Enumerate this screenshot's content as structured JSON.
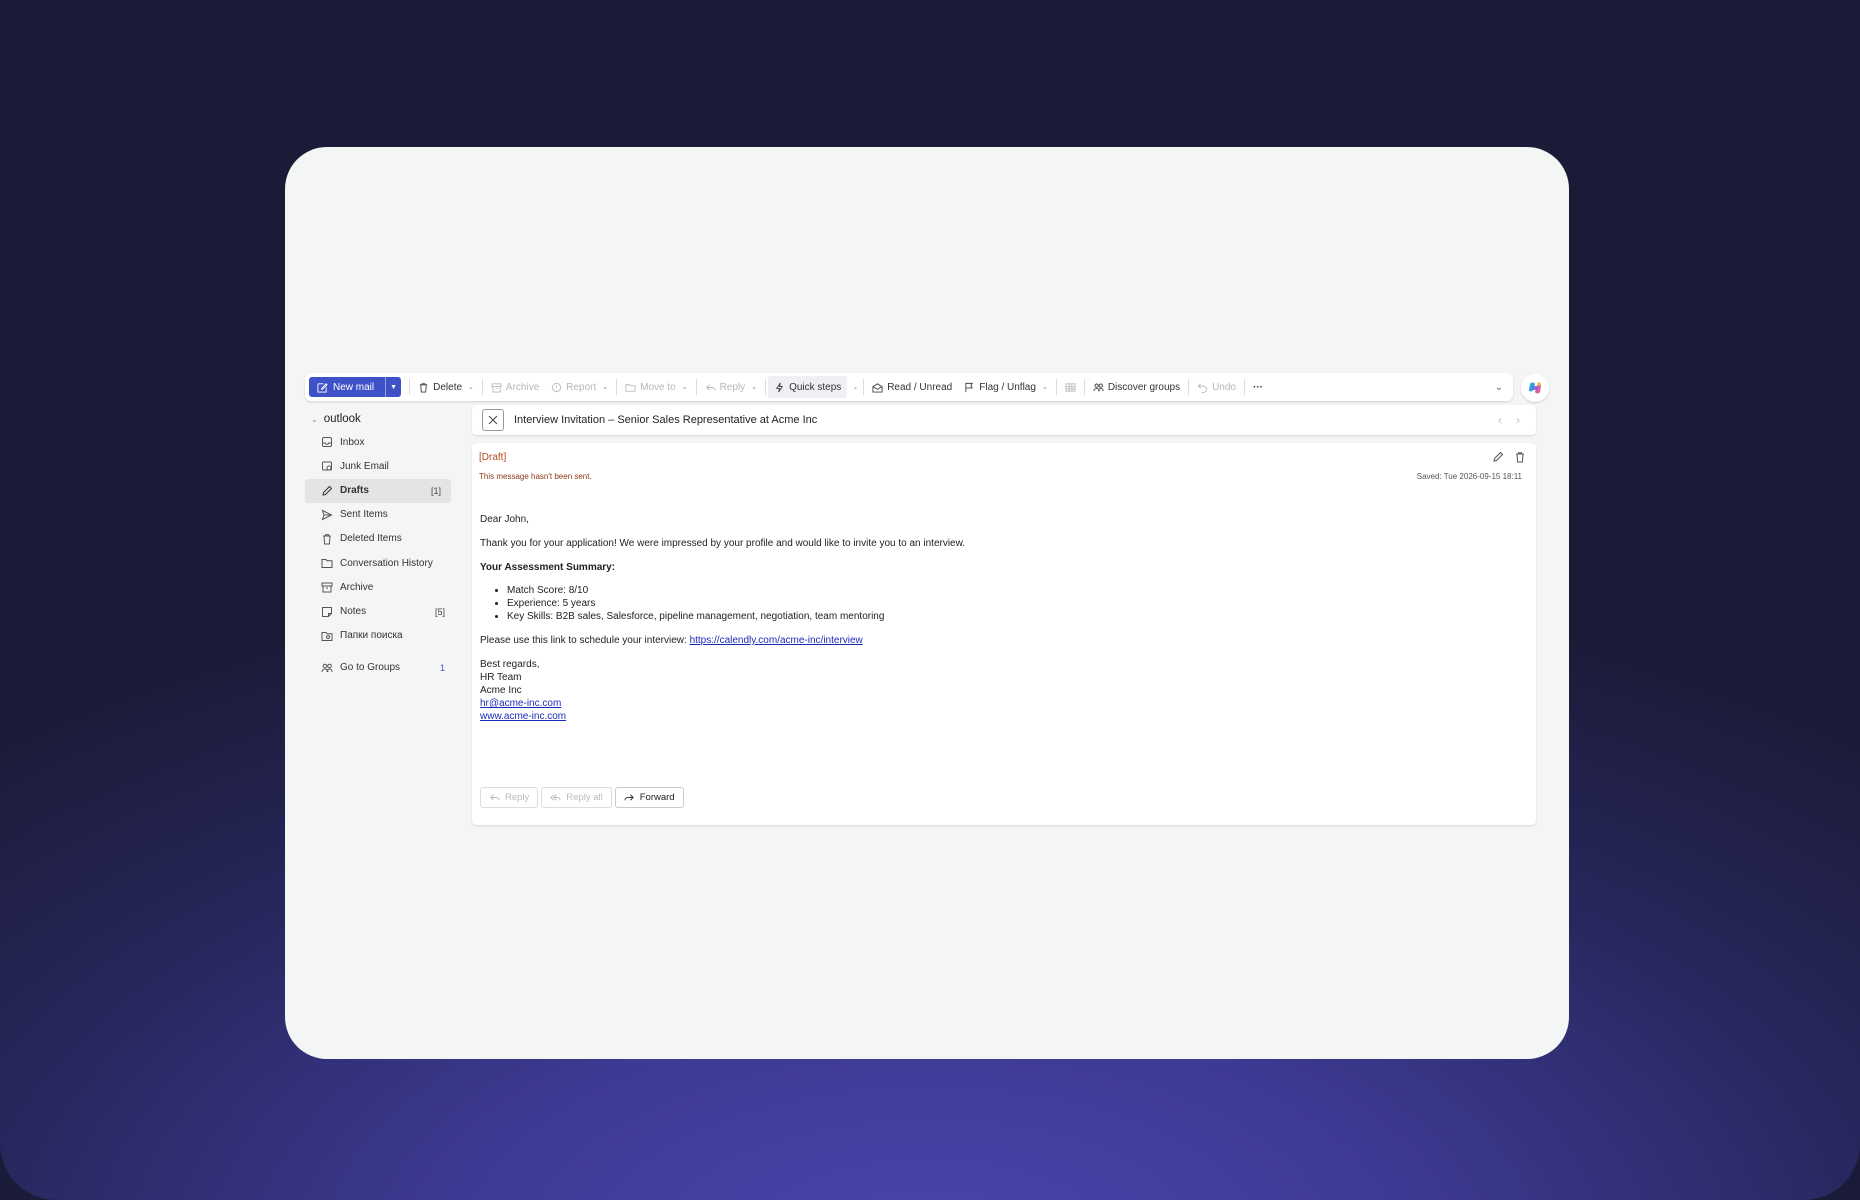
{
  "toolbar": {
    "new_mail": "New mail",
    "delete": "Delete",
    "archive": "Archive",
    "report": "Report",
    "move_to": "Move to",
    "reply": "Reply",
    "quick_steps": "Quick steps",
    "read_unread": "Read / Unread",
    "flag_unflag": "Flag / Unflag",
    "discover_groups": "Discover groups",
    "undo": "Undo",
    "more": "···"
  },
  "sidebar": {
    "account": "outlook",
    "items": [
      {
        "label": "Inbox",
        "count": "",
        "icon": "inbox-icon"
      },
      {
        "label": "Junk Email",
        "count": "",
        "icon": "junk-icon"
      },
      {
        "label": "Drafts",
        "count": "[1]",
        "icon": "pencil-icon"
      },
      {
        "label": "Sent Items",
        "count": "",
        "icon": "send-icon"
      },
      {
        "label": "Deleted Items",
        "count": "",
        "icon": "trash-icon"
      },
      {
        "label": "Conversation History",
        "count": "",
        "icon": "folder-icon"
      },
      {
        "label": "Archive",
        "count": "",
        "icon": "archive-icon"
      },
      {
        "label": "Notes",
        "count": "[5]",
        "icon": "note-icon"
      },
      {
        "label": "Папки поиска",
        "count": "",
        "icon": "search-folder-icon"
      }
    ],
    "groups": {
      "label": "Go to Groups",
      "count": "1"
    }
  },
  "message": {
    "subject": "Interview Invitation – Senior Sales Representative at Acme Inc",
    "draft_label": "[Draft]",
    "unsent_notice": "This message hasn't been sent.",
    "saved": "Saved: Tue 2026-09-15 18:11",
    "greeting": "Dear John,",
    "intro": "Thank you for your application! We were impressed by your profile and would like to invite you to an interview.",
    "summary_heading": "Your Assessment Summary:",
    "bullets": [
      "Match Score: 8/10",
      "Experience: 5 years",
      "Key Skills: B2B sales, Salesforce, pipeline management, negotiation, team mentoring"
    ],
    "link_text": "Please use this link to schedule your interview:",
    "link": "https://calendly.com/acme-inc/interview",
    "signoff": [
      "Best regards,",
      "HR Team",
      "Acme Inc"
    ],
    "email": "hr@acme-inc.com",
    "website": "www.acme-inc.com"
  },
  "actions": {
    "reply": "Reply",
    "reply_all": "Reply all",
    "forward": "Forward"
  },
  "colors": {
    "accent": "#3f51c7",
    "draft": "#b04a1d",
    "link": "#1a2bb8"
  }
}
